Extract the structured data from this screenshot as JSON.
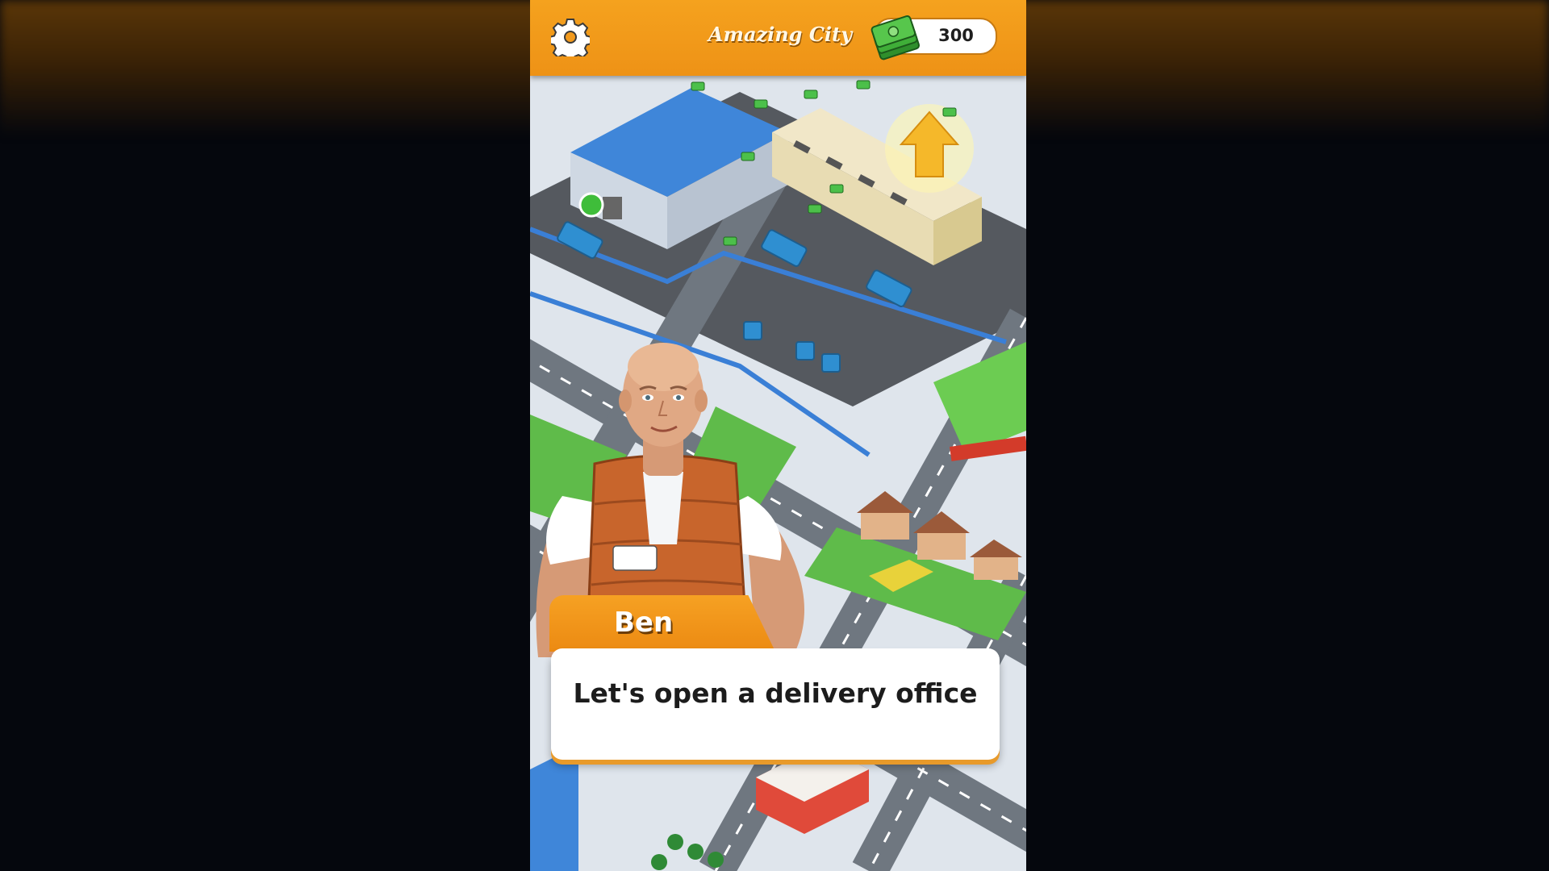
{
  "header": {
    "title": "Amazing City",
    "cash": "300",
    "settings_icon": "gear-icon",
    "cash_icon": "cash-stack-icon"
  },
  "dialogue": {
    "speaker": "Ben",
    "message": "Let's open a delivery office"
  },
  "colors": {
    "accent_orange": "#f29a1d",
    "warehouse_blue": "#3f86d9",
    "road_gray": "#6f7780",
    "grass_green": "#5fbb4a"
  }
}
